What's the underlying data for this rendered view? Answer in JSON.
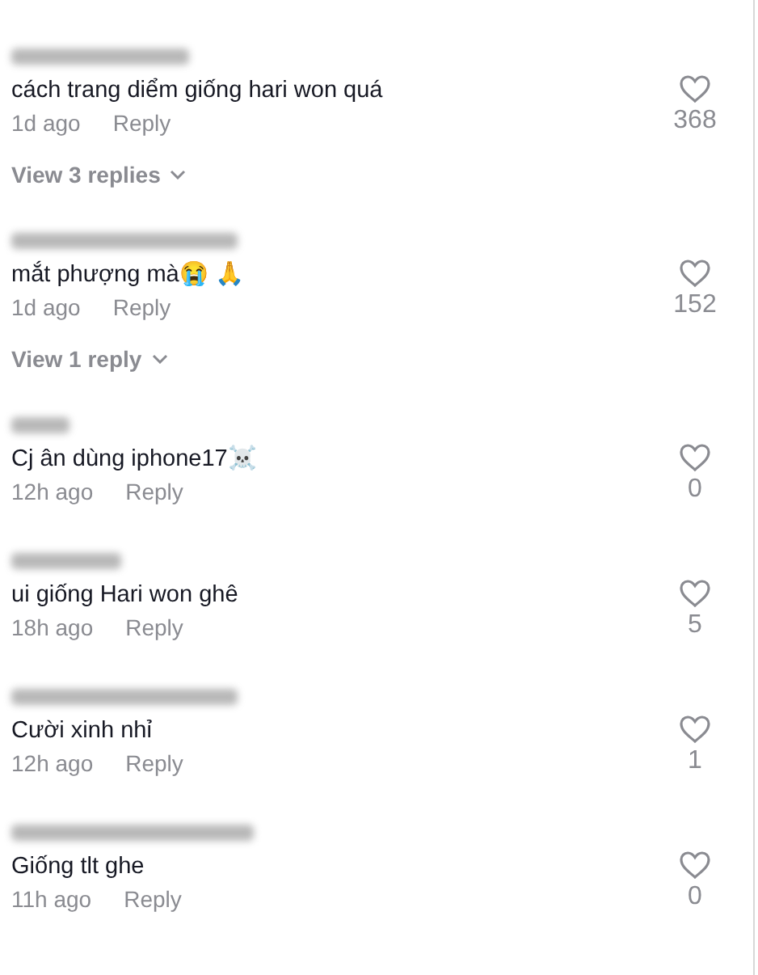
{
  "comments": [
    {
      "text": "cách trang diểm giống hari won quá",
      "time": "1d ago",
      "reply": "Reply",
      "likes": "368",
      "view_replies": "View 3 replies"
    },
    {
      "text": "mắt phượng mà😭 🙏",
      "time": "1d ago",
      "reply": "Reply",
      "likes": "152",
      "view_replies": "View 1 reply"
    },
    {
      "text": "Cj ân dùng iphone17☠️",
      "time": "12h ago",
      "reply": "Reply",
      "likes": "0"
    },
    {
      "text": "ui giống Hari won ghê",
      "time": "18h ago",
      "reply": "Reply",
      "likes": "5"
    },
    {
      "text": "Cười xinh nhỉ",
      "time": "12h ago",
      "reply": "Reply",
      "likes": "1"
    },
    {
      "text": "Giống tlt ghe",
      "time": "11h ago",
      "reply": "Reply",
      "likes": "0"
    }
  ]
}
